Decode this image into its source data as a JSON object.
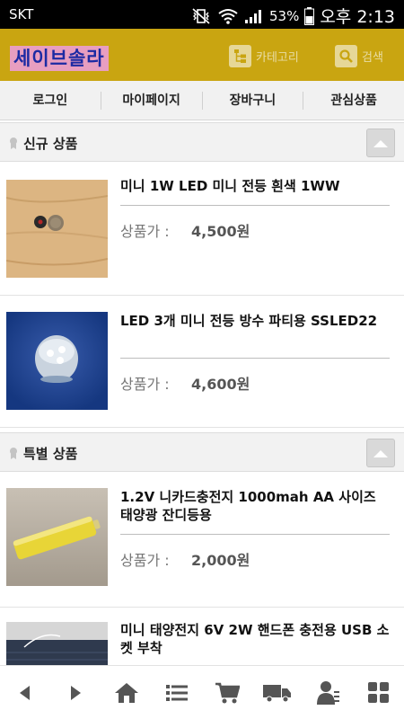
{
  "status_bar": {
    "carrier": "SKT",
    "battery": "53%",
    "time": "오후 2:13"
  },
  "header": {
    "logo": "세이브솔라",
    "category_label": "카테고리",
    "search_label": "검색"
  },
  "nav": {
    "items": [
      "로그인",
      "마이페이지",
      "장바구니",
      "관심상품"
    ]
  },
  "sections": [
    {
      "title": "신규 상품",
      "products": [
        {
          "name": "미니 1W LED 미니 전등 흰색 1WW",
          "price_label": "상품가 :",
          "price": "4,500원"
        },
        {
          "name": "LED 3개 미니 전등 방수 파티용 SSLED22",
          "price_label": "상품가 :",
          "price": "4,600원"
        }
      ]
    },
    {
      "title": "특별 상품",
      "products": [
        {
          "name": "1.2V 니카드충전지 1000mah AA 사이즈 태양광 잔디등용",
          "price_label": "상품가 :",
          "price": "2,000원"
        },
        {
          "name": "미니 태양전지 6V 2W 핸드폰 충전용 USB 소켓 부착"
        }
      ]
    }
  ],
  "colors": {
    "header_bg": "#c9a511",
    "logo_bg": "#e89ec0",
    "logo_text": "#1c2aa3",
    "nav_bg": "#f1f1f1",
    "icon_gray": "#555555"
  },
  "bottom_bar": {
    "icons": [
      "back-arrow-icon",
      "forward-arrow-icon",
      "home-icon",
      "list-icon",
      "cart-icon",
      "delivery-truck-icon",
      "user-icon",
      "grid-menu-icon"
    ]
  }
}
